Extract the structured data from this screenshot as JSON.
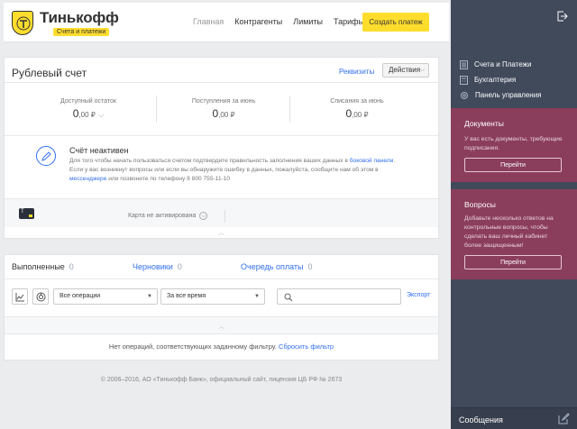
{
  "header": {
    "logo_name": "Тинькофф",
    "logo_tag": "Счета и платежи",
    "nav": [
      "Главная",
      "Контрагенты",
      "Лимиты",
      "Тарифы"
    ],
    "create_button": "Создать платеж"
  },
  "account": {
    "title": "Рублевый счет",
    "requisites_link": "Реквизиты",
    "actions_button": "Действия",
    "balances": [
      {
        "label": "Доступный остаток",
        "value": "0",
        "cents": ",00 ₽"
      },
      {
        "label": "Поступления за июнь",
        "value": "0",
        "cents": ",00 ₽"
      },
      {
        "label": "Списания за июнь",
        "value": "0",
        "cents": ",00 ₽"
      }
    ],
    "inactive_title": "Счёт неактивен",
    "inactive_text_1": "Для того чтобы начать пользоваться счетом подтвердите правильность заполнения ваших данных в",
    "inactive_link_1": "боковой панели",
    "inactive_text_2": ". Если у вас возникнут вопросы или если вы обнаружите ошибку в данных, пожалуйста, сообщите нам об этом в",
    "inactive_link_2": "мессенджере",
    "inactive_text_3": "или позвоните по телефону 8 800 755-11-10",
    "card_icon_text": "T",
    "card_status": "Карта не активирована"
  },
  "operations": {
    "tabs": [
      {
        "label": "Выполненные",
        "count": "0"
      },
      {
        "label": "Черновики",
        "count": "0"
      },
      {
        "label": "Очередь оплаты",
        "count": "0"
      }
    ],
    "filter_operations": "Все операции",
    "filter_period": "За все время",
    "search_placeholder": "",
    "export_link": "Экспорт",
    "no_ops_text": "Нет операций, соответствующих заданному фильтру.",
    "reset_filter_link": "Сбросить фильтр"
  },
  "footer": {
    "text": "© 2006–2016, АО «Тинькофф Банк», официальный сайт, лицензия ЦБ РФ № 2673"
  },
  "sidebar": {
    "menu": [
      {
        "label": "Счета и Платежи",
        "icon": "document-icon"
      },
      {
        "label": "Бухгалтерия",
        "icon": "calculator-icon"
      },
      {
        "label": "Панель управления",
        "icon": "gear-icon"
      }
    ],
    "docs_panel": {
      "title": "Документы",
      "text": "У вас есть документы, требующие подписания.",
      "button": "Перейти"
    },
    "questions_panel": {
      "title": "Вопросы",
      "text": "Добавьте несколько ответов на контрольные вопросы, чтобы сделать ваш личный кабинет более защищенным!",
      "button": "Перейти"
    },
    "messages": "Сообщения"
  },
  "colors": {
    "accent_yellow": "#ffdd2d",
    "link_blue": "#336fee",
    "sidebar_bg": "#414a5b",
    "panel_bg": "#8b3e5c"
  }
}
